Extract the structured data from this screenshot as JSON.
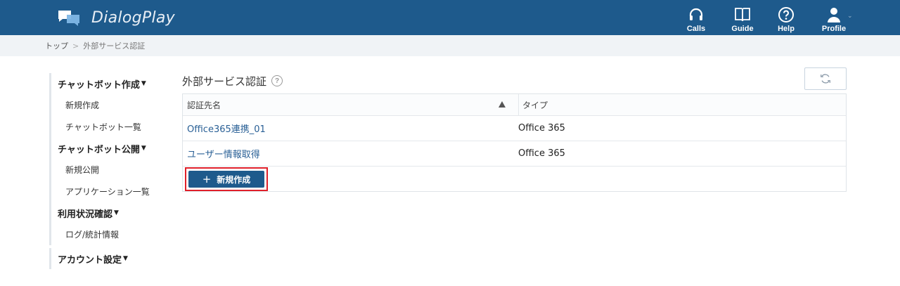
{
  "app": {
    "name": "DialogPlay",
    "logo_icon": "chat-bubbles-icon"
  },
  "header_nav": [
    {
      "label": "Calls",
      "icon": "headset-icon"
    },
    {
      "label": "Guide",
      "icon": "book-icon"
    },
    {
      "label": "Help",
      "icon": "question-icon"
    },
    {
      "label": "Profile",
      "icon": "user-icon"
    }
  ],
  "breadcrumb": {
    "home": "トップ",
    "separator": ">",
    "current": "外部サービス認証"
  },
  "sidebar": {
    "groups": [
      {
        "label": "チャットボット作成",
        "items": [
          "新規作成",
          "チャットボット一覧"
        ]
      },
      {
        "label": "チャットボット公開",
        "items": [
          "新規公開",
          "アプリケーション一覧"
        ]
      },
      {
        "label": "利用状況確認",
        "items": [
          "ログ/統計情報"
        ]
      },
      {
        "label": "アカウント設定",
        "items": []
      }
    ]
  },
  "main": {
    "title": "外部サービス認証",
    "help_symbol": "?",
    "table": {
      "columns": [
        "認証先名",
        "タイプ"
      ],
      "rows": [
        {
          "name": "Office365連携_01",
          "type": "Office 365"
        },
        {
          "name": "ユーザー情報取得",
          "type": "Office 365"
        }
      ]
    },
    "new_button": {
      "icon": "+",
      "label": "新規作成"
    }
  },
  "colors": {
    "header_bg": "#1e5a8c",
    "link": "#2a6096",
    "highlight": "#e0202a"
  }
}
